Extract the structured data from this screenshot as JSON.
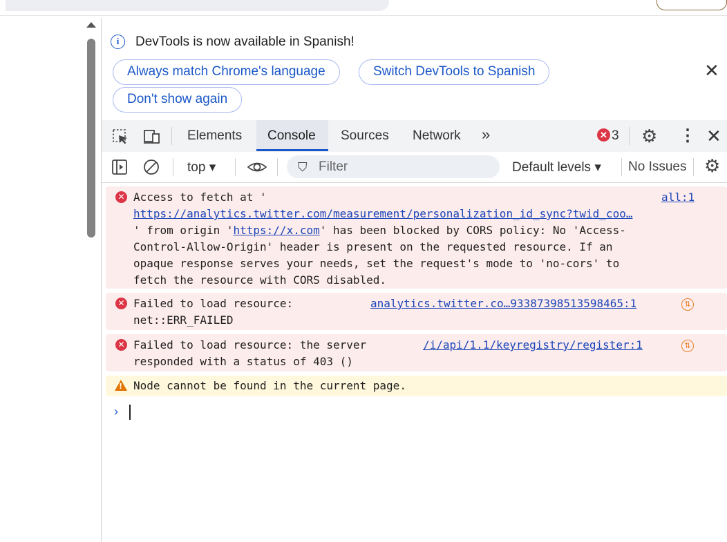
{
  "infobar": {
    "message": "DevTools is now available in Spanish!",
    "buttons": [
      "Always match Chrome's language",
      "Switch DevTools to Spanish",
      "Don't show again"
    ],
    "close_glyph": "✕"
  },
  "tabs": {
    "items": [
      "Elements",
      "Console",
      "Sources",
      "Network"
    ],
    "active": "Console",
    "more_glyph": "»",
    "error_count": "3",
    "error_badge_glyph": "✕",
    "settings_glyph": "⚙",
    "menu_glyph": "⋮",
    "close_glyph": "✕"
  },
  "toolbar": {
    "context": "top ▾",
    "filter_placeholder": "Filter",
    "filter_icon": "⛉",
    "levels": "Default levels ▾",
    "issues": "No Issues",
    "settings_glyph": "⚙"
  },
  "messages": {
    "m1": {
      "line1": "Access to fetch at '",
      "url": "https://analytics.twitter.com/measurement/personalization_id_sync?twid_coo…",
      "line3a": "' from origin '",
      "origin": "https://x.com",
      "line3b": "' has been blocked by CORS policy: No 'Access-",
      "line4": "Control-Allow-Origin' header is present on the requested resource. If an",
      "line5": "opaque response serves your needs, set the request's mode to 'no-cors' to",
      "line6": "fetch the resource with CORS disabled.",
      "source": "all:1"
    },
    "m2": {
      "line1": "Failed to load resource:",
      "line2": "net::ERR_FAILED",
      "source": "analytics.twitter.co…93387398513598465:1"
    },
    "m3": {
      "line1": "Failed to load resource: the server",
      "line2": "responded with a status of 403 ()",
      "source": "/i/api/1.1/keyregistry/register:1"
    },
    "m4": {
      "text": "Node cannot be found in the current page."
    }
  },
  "prompt": {
    "chevron": "›"
  },
  "colors": {
    "accent": "#1a57c8",
    "error": "#dc3545",
    "error_bg": "#fdecec",
    "warning": "#e37400",
    "warning_bg": "#fff8dc"
  }
}
